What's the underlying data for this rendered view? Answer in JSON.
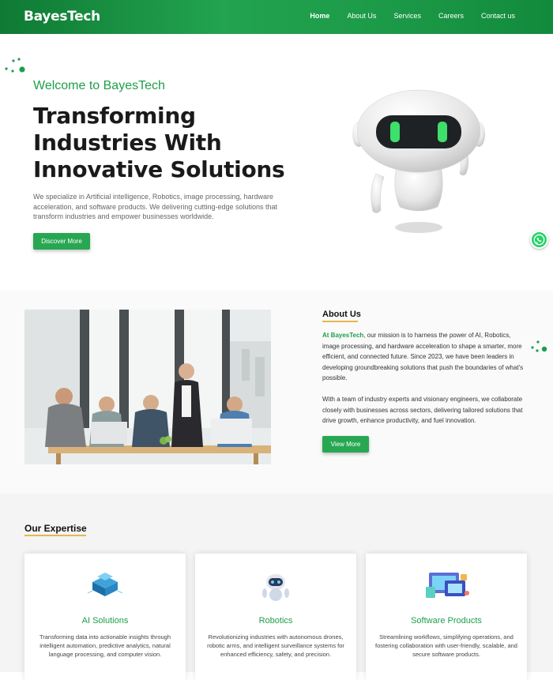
{
  "brand": {
    "logo_text": "BayesTech",
    "accent": "#1e9e4b",
    "underline": "#e8b64c"
  },
  "nav": {
    "items": [
      {
        "label": "Home"
      },
      {
        "label": "About Us"
      },
      {
        "label": "Services"
      },
      {
        "label": "Careers"
      },
      {
        "label": "Contact us"
      }
    ]
  },
  "hero": {
    "welcome": "Welcome to BayesTech",
    "title": "Transforming Industries With Innovative Solutions",
    "description": "We specialize in Artificial intelligence, Robotics, image processing, hardware acceleration, and software products. We delivering cutting-edge solutions that transform industries and empower businesses worldwide.",
    "cta_label": "Discover More",
    "robot_icon": "robot-illustration"
  },
  "floating": {
    "whatsapp_icon": "whatsapp-icon"
  },
  "about": {
    "heading": "About Us",
    "brand_name": "At BayesTech",
    "p1_rest": ", our mission is to harness the power of AI, Robotics, image processing, and hardware acceleration to shape a smarter, more efficient, and connected future. Since 2023, we have been leaders in developing groundbreaking solutions that push the boundaries of what's possible.",
    "p2": "With a team of industry experts and visionary engineers, we collaborate closely with businesses across sectors, delivering tailored solutions that drive growth, enhance productivity, and fuel innovation.",
    "cta_label": "View More"
  },
  "expertise": {
    "heading": "Our Expertise",
    "cards": [
      {
        "icon": "ai-chip-icon",
        "title": "AI Solutions",
        "description": "Transforming data into actionable insights through intelligent automation, predictive analytics, natural language processing, and computer vision."
      },
      {
        "icon": "robot-icon",
        "title": "Robotics",
        "description": "Revolutionizing industries with autonomous drones, robotic arms, and intelligent surveillance systems for enhanced efficiency, safety, and precision."
      },
      {
        "icon": "software-screens-icon",
        "title": "Software Products",
        "description": "Streamlining workflows, simplifying operations, and fostering collaboration with user-friendly, scalable, and secure software products."
      }
    ]
  }
}
